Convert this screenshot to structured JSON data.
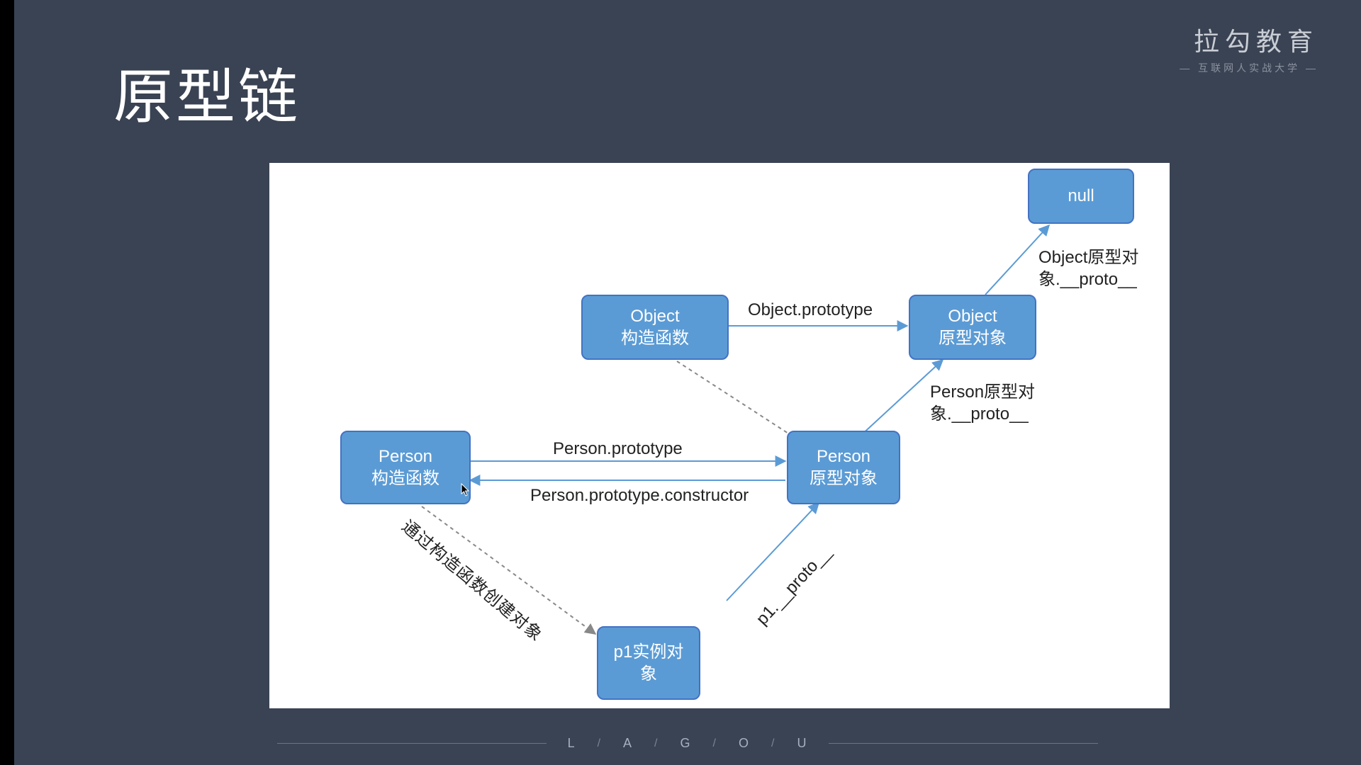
{
  "title": "原型链",
  "brand": {
    "main": "拉勾教育",
    "sub": "— 互联网人实战大学 —"
  },
  "footer": {
    "letters": [
      "L",
      "A",
      "G",
      "O",
      "U"
    ]
  },
  "nodes": {
    "null": "null",
    "objectCtor": {
      "line1": "Object",
      "line2": "构造函数"
    },
    "objectProto": {
      "line1": "Object",
      "line2": "原型对象"
    },
    "personCtor": {
      "line1": "Person",
      "line2": "构造函数"
    },
    "personProto": {
      "line1": "Person",
      "line2": "原型对象"
    },
    "p1": {
      "line1": "p1实例对",
      "line2": "象"
    }
  },
  "edges": {
    "objectPrototype": "Object.prototype",
    "objectProtoProto": {
      "line1": "Object原型对",
      "line2": "象.__proto__"
    },
    "personProtoProto": {
      "line1": "Person原型对",
      "line2": "象.__proto__"
    },
    "personPrototype": "Person.prototype",
    "personPrototypeConstructor": "Person.prototype.constructor",
    "p1Proto": "p1.__proto__",
    "createByCtor": "通过构造函数创建对象"
  },
  "chart_data": {
    "type": "diagram",
    "title": "原型链",
    "nodes": [
      {
        "id": "null",
        "label": "null"
      },
      {
        "id": "objectCtor",
        "label": "Object 构造函数"
      },
      {
        "id": "objectProto",
        "label": "Object 原型对象"
      },
      {
        "id": "personCtor",
        "label": "Person 构造函数"
      },
      {
        "id": "personProto",
        "label": "Person 原型对象"
      },
      {
        "id": "p1",
        "label": "p1实例对象"
      }
    ],
    "edges": [
      {
        "from": "objectCtor",
        "to": "objectProto",
        "label": "Object.prototype",
        "style": "solid"
      },
      {
        "from": "objectProto",
        "to": "null",
        "label": "Object原型对象.__proto__",
        "style": "solid"
      },
      {
        "from": "personCtor",
        "to": "personProto",
        "label": "Person.prototype",
        "style": "solid"
      },
      {
        "from": "personProto",
        "to": "personCtor",
        "label": "Person.prototype.constructor",
        "style": "solid"
      },
      {
        "from": "personProto",
        "to": "objectProto",
        "label": "Person原型对象.__proto__",
        "style": "solid"
      },
      {
        "from": "p1",
        "to": "personProto",
        "label": "p1.__proto__",
        "style": "solid"
      },
      {
        "from": "personCtor",
        "to": "p1",
        "label": "通过构造函数创建对象",
        "style": "dashed"
      },
      {
        "from": "objectCtor",
        "to": "personProto",
        "label": "",
        "style": "dashed"
      }
    ]
  }
}
